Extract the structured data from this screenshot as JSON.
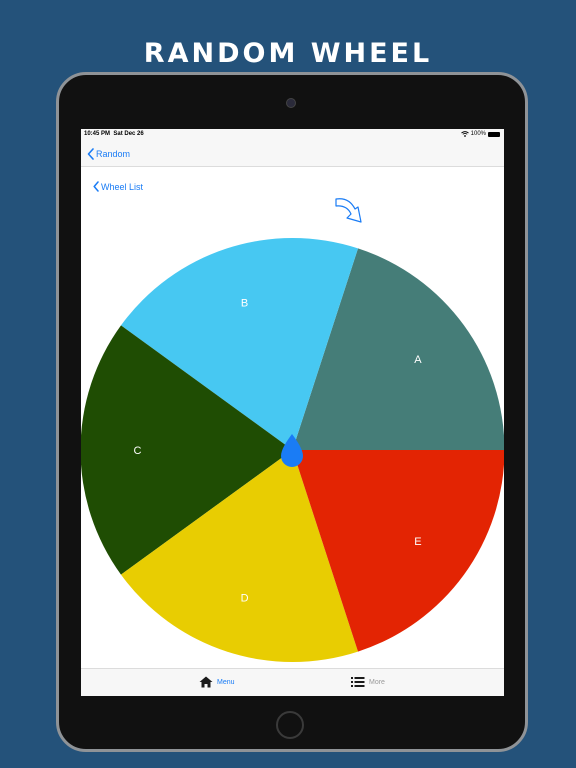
{
  "promo": {
    "headline": "RANDOM WHEEL"
  },
  "status_bar": {
    "time": "10:45 PM",
    "date": "Sat Dec 26",
    "battery": "100%"
  },
  "nav": {
    "back_label": "Random"
  },
  "page": {
    "back_label": "Wheel List"
  },
  "wheel": {
    "segments": [
      {
        "label": "A",
        "color": "#457d78"
      },
      {
        "label": "B",
        "color": "#47c8f2"
      },
      {
        "label": "C",
        "color": "#1f4d03"
      },
      {
        "label": "D",
        "color": "#e8cd02"
      },
      {
        "label": "E",
        "color": "#e32403"
      }
    ],
    "label_color": "#ffffff",
    "pointer_color": "#1a7cf5"
  },
  "tab_bar": {
    "tabs": [
      {
        "label": "Menu",
        "icon": "home-icon",
        "selected": true
      },
      {
        "label": "More",
        "icon": "list-icon",
        "selected": false
      }
    ]
  },
  "colors": {
    "background": "#24527a",
    "accent": "#1a7cf5"
  }
}
